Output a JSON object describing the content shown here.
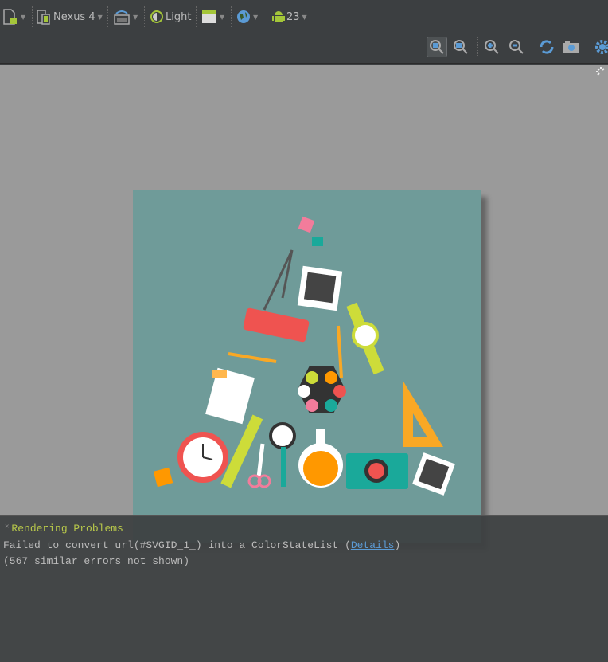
{
  "toolbar": {
    "device": "Nexus 4",
    "theme": "Light",
    "api_level": "23",
    "icons": [
      "new-config-icon",
      "device-icon",
      "orientation-icon",
      "theme-icon",
      "activity-icon",
      "locale-icon",
      "android-api-icon",
      "zoom-fit-icon",
      "zoom-actual-icon",
      "zoom-in-icon",
      "zoom-out-icon",
      "refresh-icon",
      "screenshot-icon",
      "settings-icon"
    ]
  },
  "preview": {
    "background": "#6f9b99",
    "loading_indicator": "spinner-icon"
  },
  "problems": {
    "title": "Rendering Problems",
    "message_prefix": "Failed to convert url(#SVGID_1_) into a ColorStateList (",
    "details_link": "Details",
    "message_suffix": ")",
    "similar": "(567 similar errors not shown)"
  },
  "colors": {
    "toolbar": "#3c3f41",
    "canvas": "#9a9a9a",
    "problem_title": "#b8c84a",
    "link": "#5b9bd5"
  }
}
